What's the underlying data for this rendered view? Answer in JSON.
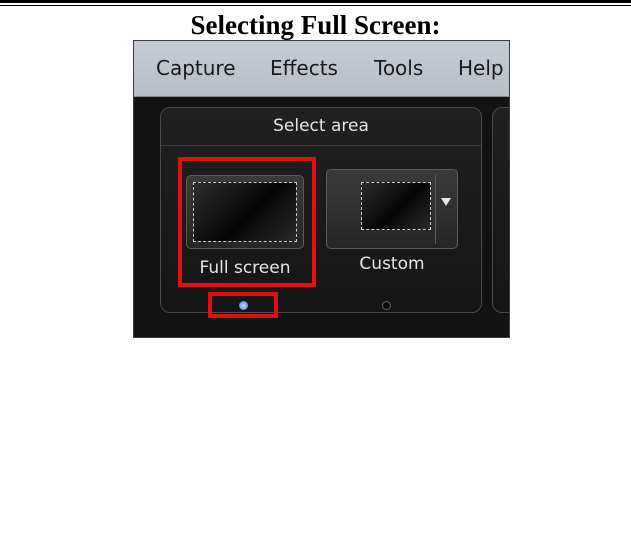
{
  "document": {
    "title": "Selecting Full Screen:"
  },
  "app": {
    "menu": [
      "Capture",
      "Effects",
      "Tools",
      "Help"
    ],
    "group": {
      "label": "Select area",
      "options": [
        {
          "label": "Full screen",
          "highlighted": true
        },
        {
          "label": "Custom",
          "has_dropdown": true,
          "highlighted": false
        }
      ],
      "page_indicator": {
        "pages": 2,
        "active_page": 1
      }
    },
    "icons": [
      "full-screen-icon",
      "custom-area-icon",
      "dropdown-arrow-icon"
    ]
  },
  "colors": {
    "highlight": "#e01010",
    "panel_background": "#161616",
    "menubar_background": "#bfc6d0",
    "active_dot": "#6f97e6"
  }
}
